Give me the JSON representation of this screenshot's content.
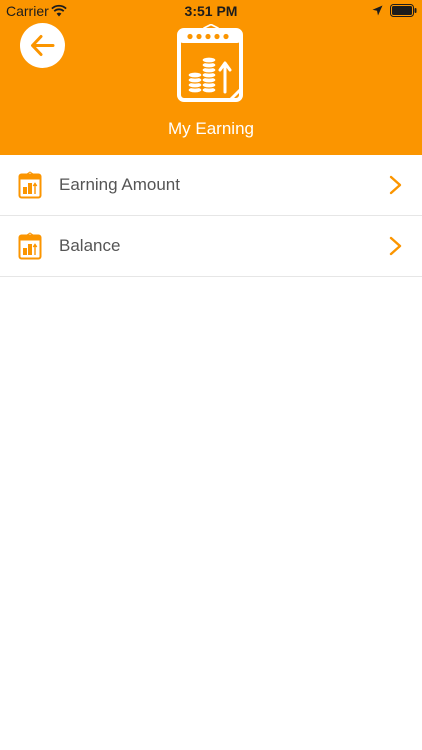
{
  "status_bar": {
    "carrier": "Carrier",
    "time": "3:51 PM",
    "icons": [
      "wifi-icon",
      "location-icon",
      "battery-icon"
    ]
  },
  "header": {
    "title": "My Earning",
    "back_icon": "arrow-left-icon",
    "illustration": "earning-calendar-icon"
  },
  "menu": {
    "items": [
      {
        "label": "Earning Amount",
        "icon": "earning-calendar-icon",
        "trailing": "chevron-right-icon"
      },
      {
        "label": "Balance",
        "icon": "earning-calendar-icon",
        "trailing": "chevron-right-icon"
      }
    ]
  },
  "colors": {
    "accent": "#fb9500",
    "text_secondary": "#555555",
    "divider": "#e6e6e6",
    "background": "#ffffff"
  }
}
